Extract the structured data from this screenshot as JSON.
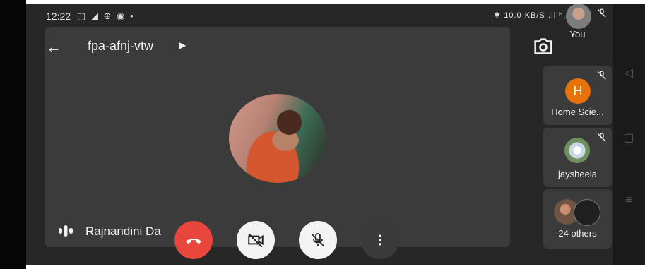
{
  "status_bar": {
    "time": "12:22",
    "icons_left": "▢ ◢ ⊕ ◉ •",
    "icons_right": "✱ 10.0 KB/S .ıl ᴴ.ıl 75"
  },
  "meeting": {
    "code": "fpa-afnj-vtw",
    "speaker_name": "Rajnandini Da"
  },
  "participants": [
    {
      "name": "You",
      "muted": true
    },
    {
      "name": "Home Scie...",
      "initial": "H",
      "muted": true
    },
    {
      "name": "jaysheela",
      "muted": true
    },
    {
      "name": "24 others"
    }
  ],
  "colors": {
    "end_call": "#e8453c",
    "avatar_h": "#e8710a",
    "background": "#272727",
    "tile": "#3b3b3b"
  },
  "icons": [
    "back-arrow-icon",
    "switch-camera-icon",
    "end-call-icon",
    "camera-off-icon",
    "mic-off-icon",
    "more-vert-icon",
    "speaker-audio-icon"
  ]
}
